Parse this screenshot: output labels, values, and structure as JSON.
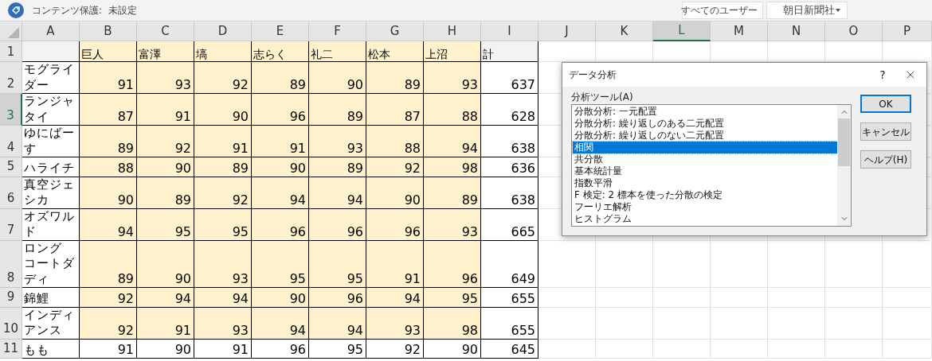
{
  "topbar": {
    "protection_label": "コンテンツ保護:",
    "protection_value": "未設定",
    "user_filter": "すべてのユーザー",
    "organization": "朝日新聞社"
  },
  "sheet": {
    "columns": [
      {
        "label": "A",
        "selected": false
      },
      {
        "label": "B",
        "selected": false
      },
      {
        "label": "C",
        "selected": false
      },
      {
        "label": "D",
        "selected": false
      },
      {
        "label": "E",
        "selected": false
      },
      {
        "label": "F",
        "selected": false
      },
      {
        "label": "G",
        "selected": false
      },
      {
        "label": "H",
        "selected": false
      },
      {
        "label": "I",
        "selected": false
      },
      {
        "label": "J",
        "selected": false
      },
      {
        "label": "K",
        "selected": false
      },
      {
        "label": "L",
        "selected": true
      },
      {
        "label": "M",
        "selected": false
      },
      {
        "label": "N",
        "selected": false
      },
      {
        "label": "O",
        "selected": false
      },
      {
        "label": "P",
        "selected": false
      }
    ],
    "header_row": {
      "number": "1",
      "selected": false,
      "headers": [
        "巨人",
        "富澤",
        "塙",
        "志らく",
        "礼二",
        "松本",
        "上沼",
        "計"
      ]
    },
    "rows": [
      {
        "number": "2",
        "selected": false,
        "highlighted": true,
        "name": "モグライダー",
        "scores": [
          "91",
          "93",
          "92",
          "89",
          "90",
          "89",
          "93"
        ],
        "total": "637"
      },
      {
        "number": "3",
        "selected": true,
        "highlighted": true,
        "name": "ランジャタイ",
        "scores": [
          "87",
          "91",
          "90",
          "96",
          "89",
          "87",
          "88"
        ],
        "total": "628"
      },
      {
        "number": "4",
        "selected": false,
        "highlighted": true,
        "name": "ゆにばーす",
        "scores": [
          "89",
          "92",
          "91",
          "91",
          "93",
          "88",
          "94"
        ],
        "total": "638"
      },
      {
        "number": "5",
        "selected": false,
        "highlighted": true,
        "name": "ハライチ",
        "scores": [
          "88",
          "90",
          "89",
          "90",
          "89",
          "92",
          "98"
        ],
        "total": "636"
      },
      {
        "number": "6",
        "selected": false,
        "highlighted": true,
        "name": "真空ジェシカ",
        "scores": [
          "90",
          "89",
          "92",
          "94",
          "94",
          "90",
          "89"
        ],
        "total": "638"
      },
      {
        "number": "7",
        "selected": false,
        "highlighted": true,
        "name": "オズワルド",
        "scores": [
          "94",
          "95",
          "95",
          "96",
          "96",
          "96",
          "93"
        ],
        "total": "665"
      },
      {
        "number": "8",
        "selected": false,
        "highlighted": true,
        "name": "ロングコートダディ",
        "scores": [
          "89",
          "90",
          "93",
          "95",
          "95",
          "91",
          "96"
        ],
        "total": "649"
      },
      {
        "number": "9",
        "selected": false,
        "highlighted": true,
        "name": "錦鯉",
        "scores": [
          "92",
          "94",
          "94",
          "90",
          "96",
          "94",
          "95"
        ],
        "total": "655"
      },
      {
        "number": "10",
        "selected": false,
        "highlighted": true,
        "name": "インディアンス",
        "scores": [
          "92",
          "91",
          "93",
          "94",
          "94",
          "93",
          "98"
        ],
        "total": "655"
      },
      {
        "number": "11",
        "selected": false,
        "highlighted": false,
        "name": "もも",
        "scores": [
          "91",
          "90",
          "91",
          "96",
          "95",
          "92",
          "90"
        ],
        "total": "645"
      }
    ]
  },
  "dialog": {
    "title": "データ分析",
    "help_glyph": "?",
    "label": "分析ツール(A)",
    "tools": [
      {
        "label": "分散分析: 一元配置",
        "selected": false
      },
      {
        "label": "分散分析: 繰り返しのある二元配置",
        "selected": false
      },
      {
        "label": "分散分析: 繰り返しのない二元配置",
        "selected": false
      },
      {
        "label": "相関",
        "selected": true
      },
      {
        "label": "共分散",
        "selected": false
      },
      {
        "label": "基本統計量",
        "selected": false
      },
      {
        "label": "指数平滑",
        "selected": false
      },
      {
        "label": "F 検定: 2 標本を使った分散の検定",
        "selected": false
      },
      {
        "label": "フーリエ解析",
        "selected": false
      },
      {
        "label": "ヒストグラム",
        "selected": false
      }
    ],
    "buttons": [
      {
        "label": "OK",
        "primary": true
      },
      {
        "label": "キャンセル",
        "primary": false
      },
      {
        "label": "ヘルプ(H)",
        "primary": false
      }
    ]
  }
}
